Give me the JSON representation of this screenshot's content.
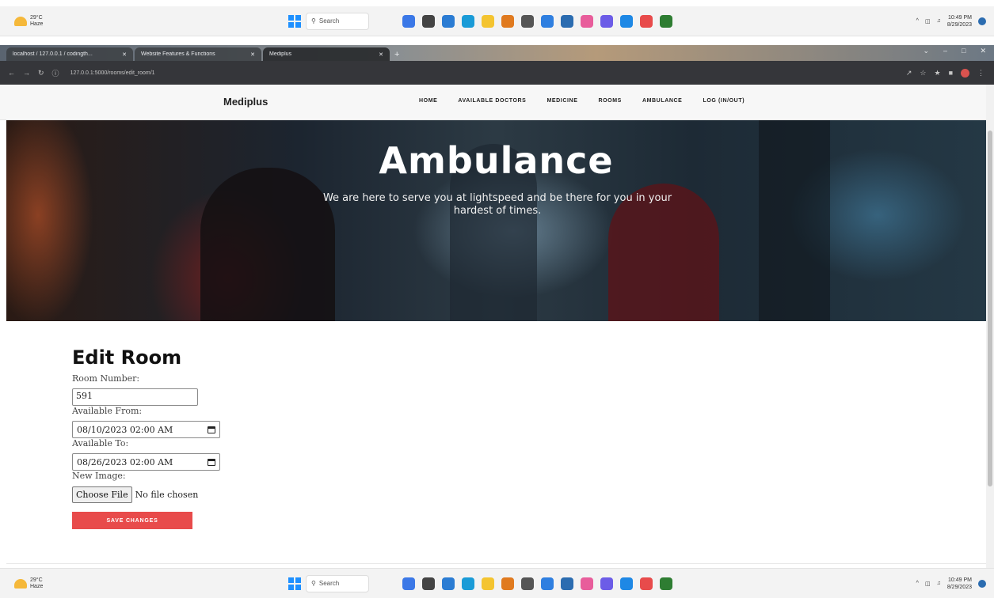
{
  "taskbar": {
    "weather_temp": "29°C",
    "weather_desc": "Haze",
    "search_label": "Search",
    "time": "10:49 PM",
    "date": "8/29/2023",
    "app_colors": [
      "#3b78e7",
      "#444444",
      "#2b7cd3",
      "#1a9bd7",
      "#f4c430",
      "#e07a1f",
      "#555555",
      "#2f7fe0",
      "#2b6cb0",
      "#e85d9b",
      "#6c5ce7",
      "#1e88e5",
      "#e84b4b",
      "#2e7d32"
    ]
  },
  "browser": {
    "tabs": [
      {
        "title": "localhost / 127.0.0.1 / codingth..."
      },
      {
        "title": "Website Features & Functions"
      },
      {
        "title": "Mediplus"
      }
    ],
    "url": "127.0.0.1:5000/rooms/edit_room/1"
  },
  "site": {
    "brand": "Mediplus",
    "nav": [
      "HOME",
      "AVAILABLE DOCTORS",
      "MEDICINE",
      "ROOMS",
      "AMBULANCE",
      "LOG (IN/OUT)"
    ]
  },
  "hero": {
    "title": "Ambulance",
    "subtitle": "We are here to serve you at lightspeed and be there for you in your hardest of times."
  },
  "form": {
    "title": "Edit Room",
    "room_number_label": "Room Number:",
    "room_number_value": "591",
    "available_from_label": "Available From:",
    "available_from_value": "08/10/2023 02:00 AM",
    "available_to_label": "Available To:",
    "available_to_value": "08/26/2023 02:00 AM",
    "new_image_label": "New Image:",
    "choose_file_label": "Choose File",
    "file_status": "No file chosen",
    "save_label": "SAVE CHANGES",
    "save_color": "#e84b4b"
  }
}
